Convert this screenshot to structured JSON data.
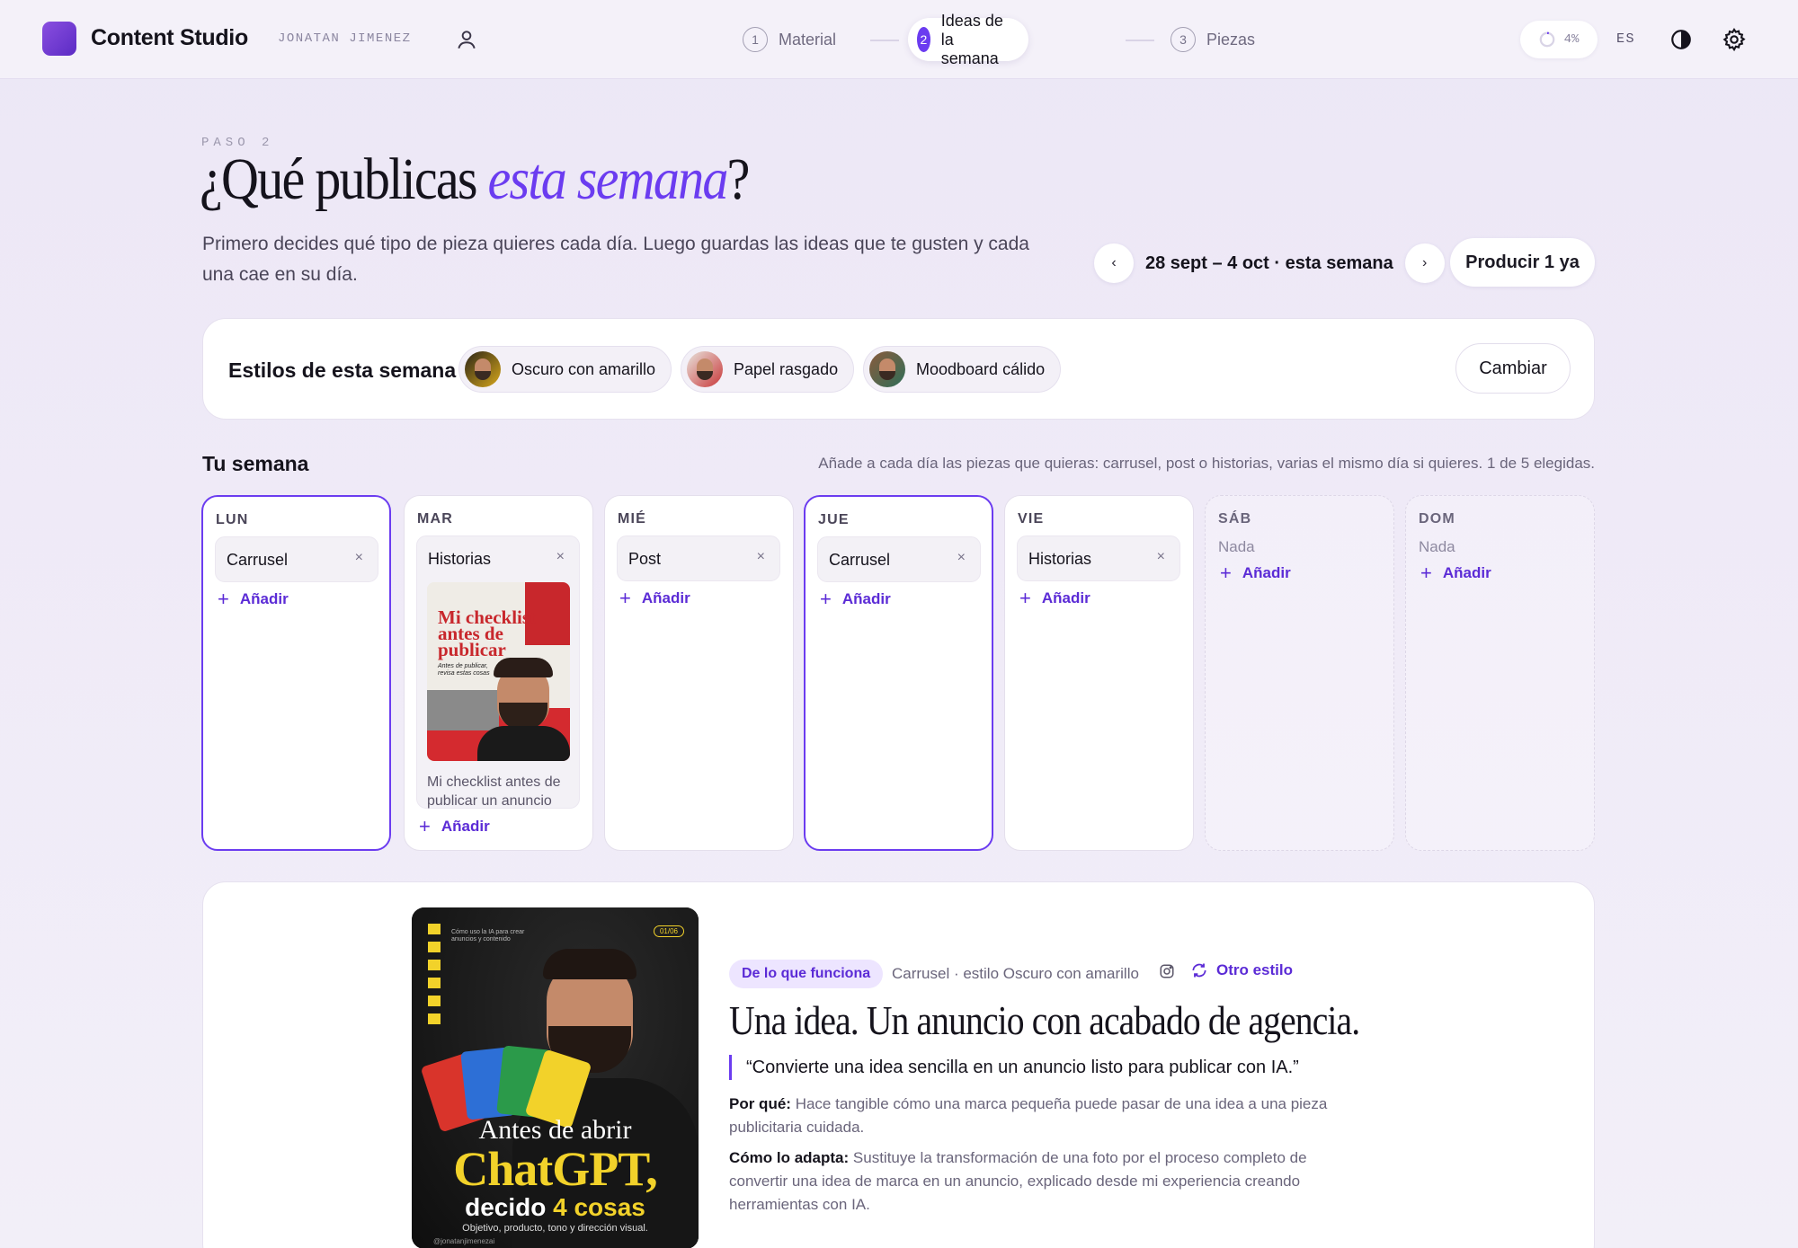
{
  "app": {
    "title": "Content Studio",
    "user": "JONATAN JIMENEZ"
  },
  "steps": [
    {
      "num": "1",
      "label": "Material"
    },
    {
      "num": "2",
      "label": "Ideas de la semana"
    },
    {
      "num": "3",
      "label": "Piezas"
    }
  ],
  "topbar": {
    "progress": "4%",
    "lang": "ES"
  },
  "header": {
    "kicker": "PASO 2",
    "title_a": "¿Qué publicas ",
    "title_em": "esta semana",
    "title_b": "?",
    "subtitle": "Primero decides qué tipo de pieza quieres cada día. Luego guardas las ideas que te gusten y cada una cae en su día.",
    "prev": "‹",
    "next": "›",
    "week_label": "28 sept – 4 oct · esta semana",
    "produce": "Producir 1 ya"
  },
  "styles": {
    "label": "Estilos de esta semana",
    "chips": [
      "Oscuro con amarillo",
      "Papel rasgado",
      "Moodboard cálido"
    ],
    "change": "Cambiar"
  },
  "week": {
    "title": "Tu semana",
    "hint": "Añade a cada día las piezas que quieras: carrusel, post o historias, varias el mismo día si quieres. 1 de 5 elegidas.",
    "add": "Añadir",
    "nada": "Nada",
    "remove": "×",
    "days": [
      {
        "name": "LUN",
        "piece": "Carrusel"
      },
      {
        "name": "MAR",
        "piece": "Historias",
        "caption": "Mi checklist antes de publicar un anuncio",
        "thumb_lines": [
          "Mi checklist",
          "antes de",
          "publicar"
        ],
        "thumb_sub": "Antes de publicar, revisa estas cosas"
      },
      {
        "name": "MIÉ",
        "piece": "Post"
      },
      {
        "name": "JUE",
        "piece": "Carrusel"
      },
      {
        "name": "VIE",
        "piece": "Historias"
      },
      {
        "name": "SÁB"
      },
      {
        "name": "DOM"
      }
    ]
  },
  "idea": {
    "origin": "De lo que funciona",
    "meta": "Carrusel · estilo Oscuro con amarillo",
    "other_style": "Otro estilo",
    "title": "Una idea. Un anuncio con acabado de agencia.",
    "quote": "“Convierte una idea sencilla en un anuncio listo para publicar con IA.”",
    "why_label": "Por qué:",
    "why": "Hace tangible cómo una marca pequeña puede pasar de una idea a una pieza publicitaria cuidada.",
    "adapt_label": "Cómo lo adapta:",
    "adapt": "Sustituye la transformación de una foto por el proceso completo de convertir una idea de marca en un anuncio, explicado desde mi experiencia creando herramientas con IA.",
    "cover": {
      "page": "01/06",
      "kicker": "Cómo uso la IA para crear anuncios y contenido",
      "line1": "Antes de abrir",
      "line2": "ChatGPT,",
      "line3a": "decido ",
      "line3b": "4 cosas",
      "sub": "Objetivo, producto, tono y dirección visual.",
      "handle": "@jonatanjimenezai"
    }
  }
}
